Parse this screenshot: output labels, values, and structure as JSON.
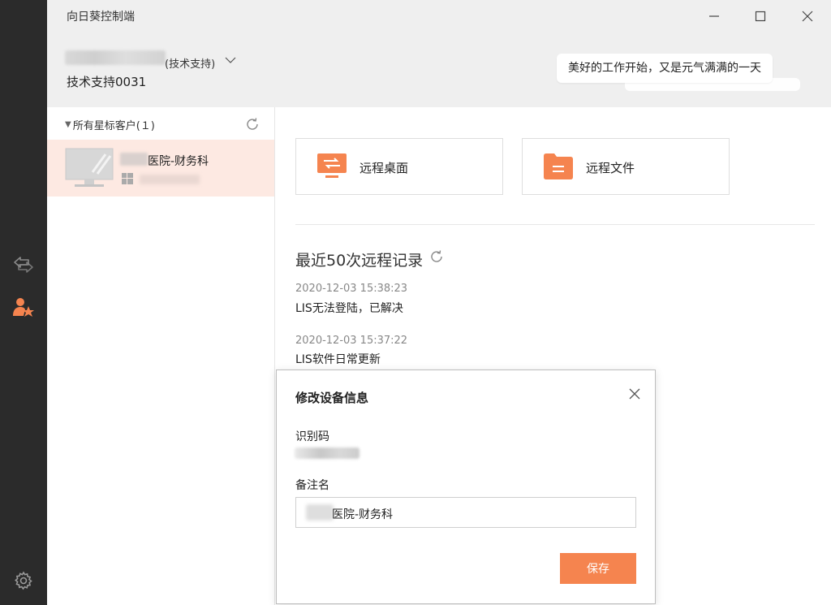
{
  "app": {
    "title": "向日葵控制端"
  },
  "window_controls": {
    "minimize_icon": "minimize-icon",
    "maximize_icon": "maximize-icon",
    "close_icon": "close-icon"
  },
  "rail": {
    "items": [
      {
        "name": "remote-connect-icon",
        "active": false
      },
      {
        "name": "starred-clients-icon",
        "active": true
      },
      {
        "name": "settings-icon",
        "active": false
      }
    ]
  },
  "account": {
    "role": "(技术支持)",
    "id": "技术支持0031"
  },
  "greeting": "美好的工作开始，又是元气满满的一天",
  "clients": {
    "group_label": "所有星标客户(１)",
    "devices": [
      {
        "name": "医院-财务科",
        "os": "windows"
      }
    ]
  },
  "actions": {
    "remote_desktop": "远程桌面",
    "remote_files": "远程文件"
  },
  "records": {
    "title": "最近50次远程记录",
    "items": [
      {
        "time": "2020-12-03 15:38:23",
        "text": "LIS无法登陆，已解决"
      },
      {
        "time": "2020-12-03 15:37:22",
        "text": "LIS软件日常更新"
      }
    ]
  },
  "dialog": {
    "title": "修改设备信息",
    "id_label": "识别码",
    "remark_label": "备注名",
    "remark_value": "医院-财务科",
    "save_label": "保存"
  },
  "colors": {
    "accent": "#f5844f",
    "rail": "#2b2b2b",
    "header": "#efefef",
    "selected_row": "#fde9e2"
  }
}
